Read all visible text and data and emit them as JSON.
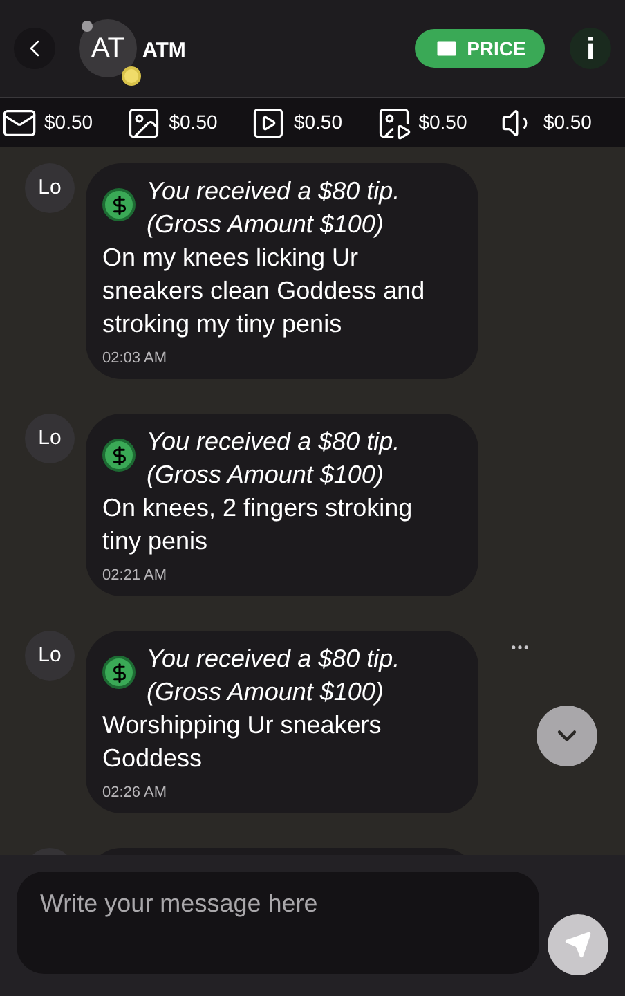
{
  "header": {
    "avatar_initials": "AT",
    "name": "ATM",
    "price_button": "PRICE",
    "info_button": "i"
  },
  "prices": [
    {
      "kind": "message",
      "price": "$0.50"
    },
    {
      "kind": "photo",
      "price": "$0.50"
    },
    {
      "kind": "video",
      "price": "$0.50"
    },
    {
      "kind": "gif",
      "price": "$0.50"
    },
    {
      "kind": "audio",
      "price": "$0.50"
    }
  ],
  "messages": [
    {
      "sender": "Lo",
      "tip": "You received a $80 tip.",
      "gross": "(Gross Amount $100)",
      "body": "On my knees licking Ur sneakers clean Goddess and stroking my tiny penis",
      "time": "02:03 AM",
      "menu_shown": false
    },
    {
      "sender": "Lo",
      "tip": "You received a $80 tip.",
      "gross": "(Gross Amount $100)",
      "body": "On knees, 2 fingers stroking tiny penis",
      "time": "02:21 AM",
      "menu_shown": false
    },
    {
      "sender": "Lo",
      "tip": "You received a $80 tip.",
      "gross": "(Gross Amount $100)",
      "body": "Worshipping Ur sneakers Goddess",
      "time": "02:26 AM",
      "menu_shown": true
    }
  ],
  "composer": {
    "placeholder": "Write your message here"
  }
}
